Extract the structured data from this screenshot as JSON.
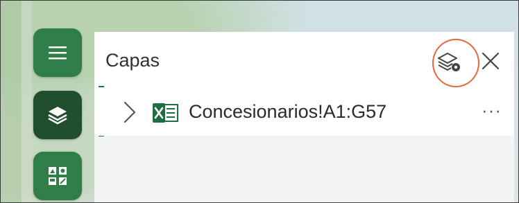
{
  "panel": {
    "title": "Capas"
  },
  "layers": [
    {
      "name": "Concesionarios!A1:G57",
      "type_icon": "excel-icon"
    }
  ],
  "more_label": "···",
  "icons": {
    "menu": "hamburger-icon",
    "layers": "layers-icon",
    "legend": "legend-icon",
    "layer_settings": "layers-settings-icon",
    "close": "close-icon",
    "expand": "chevron-right-icon"
  },
  "colors": {
    "primary_green": "#2f7d47",
    "active_green": "#1f4f2c",
    "highlight": "#e8663c",
    "accent_bar": "#1f7a3f"
  }
}
